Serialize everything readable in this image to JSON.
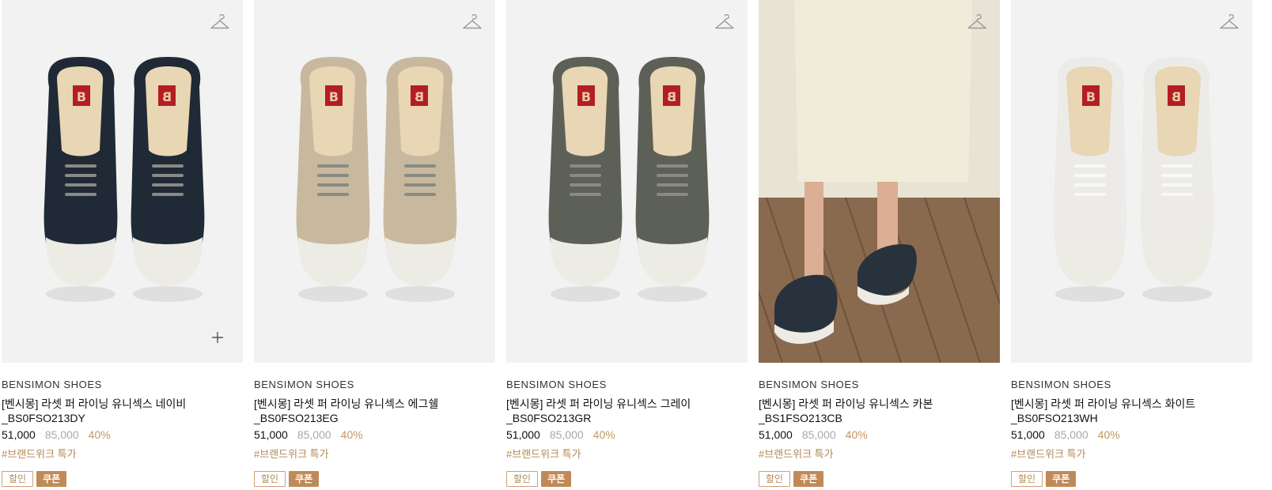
{
  "products": [
    {
      "brand": "BENSIMON SHOES",
      "name": "[벤시몽] 라셋 퍼 라이닝 유니섹스 네이비",
      "code": "_BS0FSO213DY",
      "price": "51,000",
      "original_price": "85,000",
      "discount": "40%",
      "tag": "#브랜드위크 특가",
      "badge_sale": "할인",
      "badge_coupon": "쿠폰",
      "shoe_color": "#1f2a36",
      "image_type": "shoes-top",
      "show_plus": true
    },
    {
      "brand": "BENSIMON SHOES",
      "name": "[벤시몽] 라셋 퍼 라이닝 유니섹스 에그쉘",
      "code": "_BS0FSO213EG",
      "price": "51,000",
      "original_price": "85,000",
      "discount": "40%",
      "tag": "#브랜드위크 특가",
      "badge_sale": "할인",
      "badge_coupon": "쿠폰",
      "shoe_color": "#c8b89e",
      "image_type": "shoes-top",
      "show_plus": false
    },
    {
      "brand": "BENSIMON SHOES",
      "name": "[벤시몽] 라셋 퍼 라이닝 유니섹스 그레이",
      "code": "_BS0FSO213GR",
      "price": "51,000",
      "original_price": "85,000",
      "discount": "40%",
      "tag": "#브랜드위크 특가",
      "badge_sale": "할인",
      "badge_coupon": "쿠폰",
      "shoe_color": "#5d6057",
      "image_type": "shoes-top",
      "show_plus": false
    },
    {
      "brand": "BENSIMON SHOES",
      "name": "[벤시몽] 라셋 퍼 라이닝 유니섹스 카본",
      "code": "_BS1FSO213CB",
      "price": "51,000",
      "original_price": "85,000",
      "discount": "40%",
      "tag": "#브랜드위크 특가",
      "badge_sale": "할인",
      "badge_coupon": "쿠폰",
      "shoe_color": "#28323d",
      "image_type": "model-wearing",
      "show_plus": false
    },
    {
      "brand": "BENSIMON SHOES",
      "name": "[벤시몽] 라셋 퍼 라이닝 유니섹스 화이트",
      "code": "_BS0FSO213WH",
      "price": "51,000",
      "original_price": "85,000",
      "discount": "40%",
      "tag": "#브랜드위크 특가",
      "badge_sale": "할인",
      "badge_coupon": "쿠폰",
      "shoe_color": "#ecebe7",
      "image_type": "shoes-top",
      "show_plus": false
    }
  ],
  "icons": {
    "wishlist": "hanger-icon",
    "quick_view": "plus-icon"
  },
  "colors": {
    "accent": "#c08a57",
    "tag_text": "#b08a55",
    "original_price": "#a8a8a8",
    "image_bg": "#f2f2f2"
  }
}
